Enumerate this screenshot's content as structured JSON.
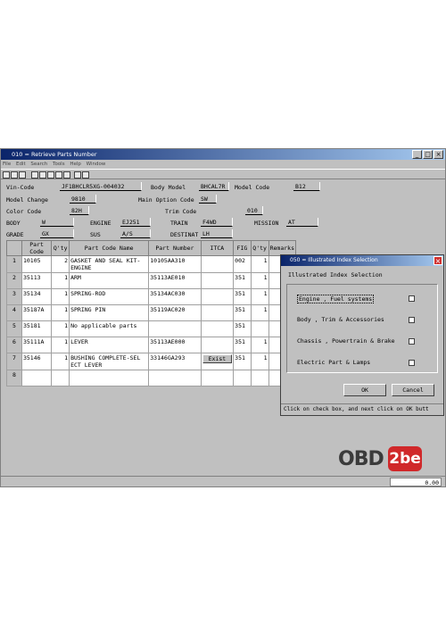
{
  "window": {
    "title": "010 = Retrieve Parts Number"
  },
  "menu": [
    "File",
    "Edit",
    "Search",
    "Tools",
    "Help",
    "Window"
  ],
  "header": {
    "vin_label": "Vin-Code",
    "vin_value": "JF1BHCLR5XG-004032",
    "body_model_label": "Body Model",
    "body_model_value": "BHCAL7R",
    "model_code_label": "Model Code",
    "model_code_value": "B12",
    "model_change_label": "Model Change",
    "model_change_value": "9810",
    "main_option_label": "Main Option Code",
    "main_option_value": "SW",
    "color_code_label": "Color Code",
    "color_code_value": "82H",
    "trim_code_label": "Trim Code",
    "trim_code_value": "010",
    "body_label": "BODY",
    "body_value": "W",
    "engine_label": "ENGINE",
    "engine_value": "EJ251",
    "train_label": "TRAIN",
    "train_value": "F4WD",
    "mission_label": "MISSION",
    "mission_value": "AT",
    "grade_label": "GRADE",
    "grade_value": "GX",
    "sus_label": "SUS",
    "sus_value": "A/S",
    "destinat_label": "DESTINAT",
    "destinat_value": "LH"
  },
  "table": {
    "headers": [
      "Part Code",
      "Q'ty",
      "Part Code Name",
      "Part Number",
      "ITCA",
      "FIG",
      "Q'ty",
      "Remarks"
    ],
    "rows": [
      {
        "n": "1",
        "code": "10105",
        "qty": "2",
        "name1": "GASKET AND SEAL KIT-",
        "name2": "ENGINE",
        "number": "10105AA310",
        "itca": "",
        "fig": "002",
        "qty2": "1"
      },
      {
        "n": "2",
        "code": "35113",
        "qty": "1",
        "name1": "ARM",
        "name2": "",
        "number": "35113AE010",
        "itca": "",
        "fig": "351",
        "qty2": "1"
      },
      {
        "n": "3",
        "code": "35134",
        "qty": "1",
        "name1": "SPRING-ROD",
        "name2": "",
        "number": "35134AC030",
        "itca": "",
        "fig": "351",
        "qty2": "1"
      },
      {
        "n": "4",
        "code": "35187A",
        "qty": "1",
        "name1": "SPRING PIN",
        "name2": "",
        "number": "35119AC020",
        "itca": "",
        "fig": "351",
        "qty2": "1"
      },
      {
        "n": "5",
        "code": "35181",
        "qty": "1",
        "name1": "No applicable parts",
        "name2": "",
        "number": "",
        "itca": "",
        "fig": "351",
        "qty2": ""
      },
      {
        "n": "6",
        "code": "35111A",
        "qty": "1",
        "name1": "LEVER",
        "name2": "",
        "number": "35113AE000",
        "itca": "",
        "fig": "351",
        "qty2": "1"
      },
      {
        "n": "7",
        "code": "35146",
        "qty": "1",
        "name1": "BUSHING COMPLETE-SEL",
        "name2": "ECT LEVER",
        "number": "33146GA293",
        "itca": "Exist",
        "fig": "351",
        "qty2": "1"
      },
      {
        "n": "8",
        "code": "",
        "qty": "",
        "name1": "",
        "name2": "",
        "number": "",
        "itca": "",
        "fig": "",
        "qty2": ""
      }
    ]
  },
  "dialog": {
    "title": "050 = Illustrated Index Selection",
    "heading": "Illustrated Index Selection",
    "options": [
      "Engine , Fuel systems",
      "Body , Trim & Accessories",
      "Chassis , Powertrain & Brake",
      "Electric Part & Lamps"
    ],
    "ok": "OK",
    "cancel": "Cancel",
    "hint": "Click on check box, and next click on OK butt"
  },
  "status": {
    "value": "0.00"
  },
  "logo": {
    "text_a": "OBD",
    "text_b": "2be"
  }
}
